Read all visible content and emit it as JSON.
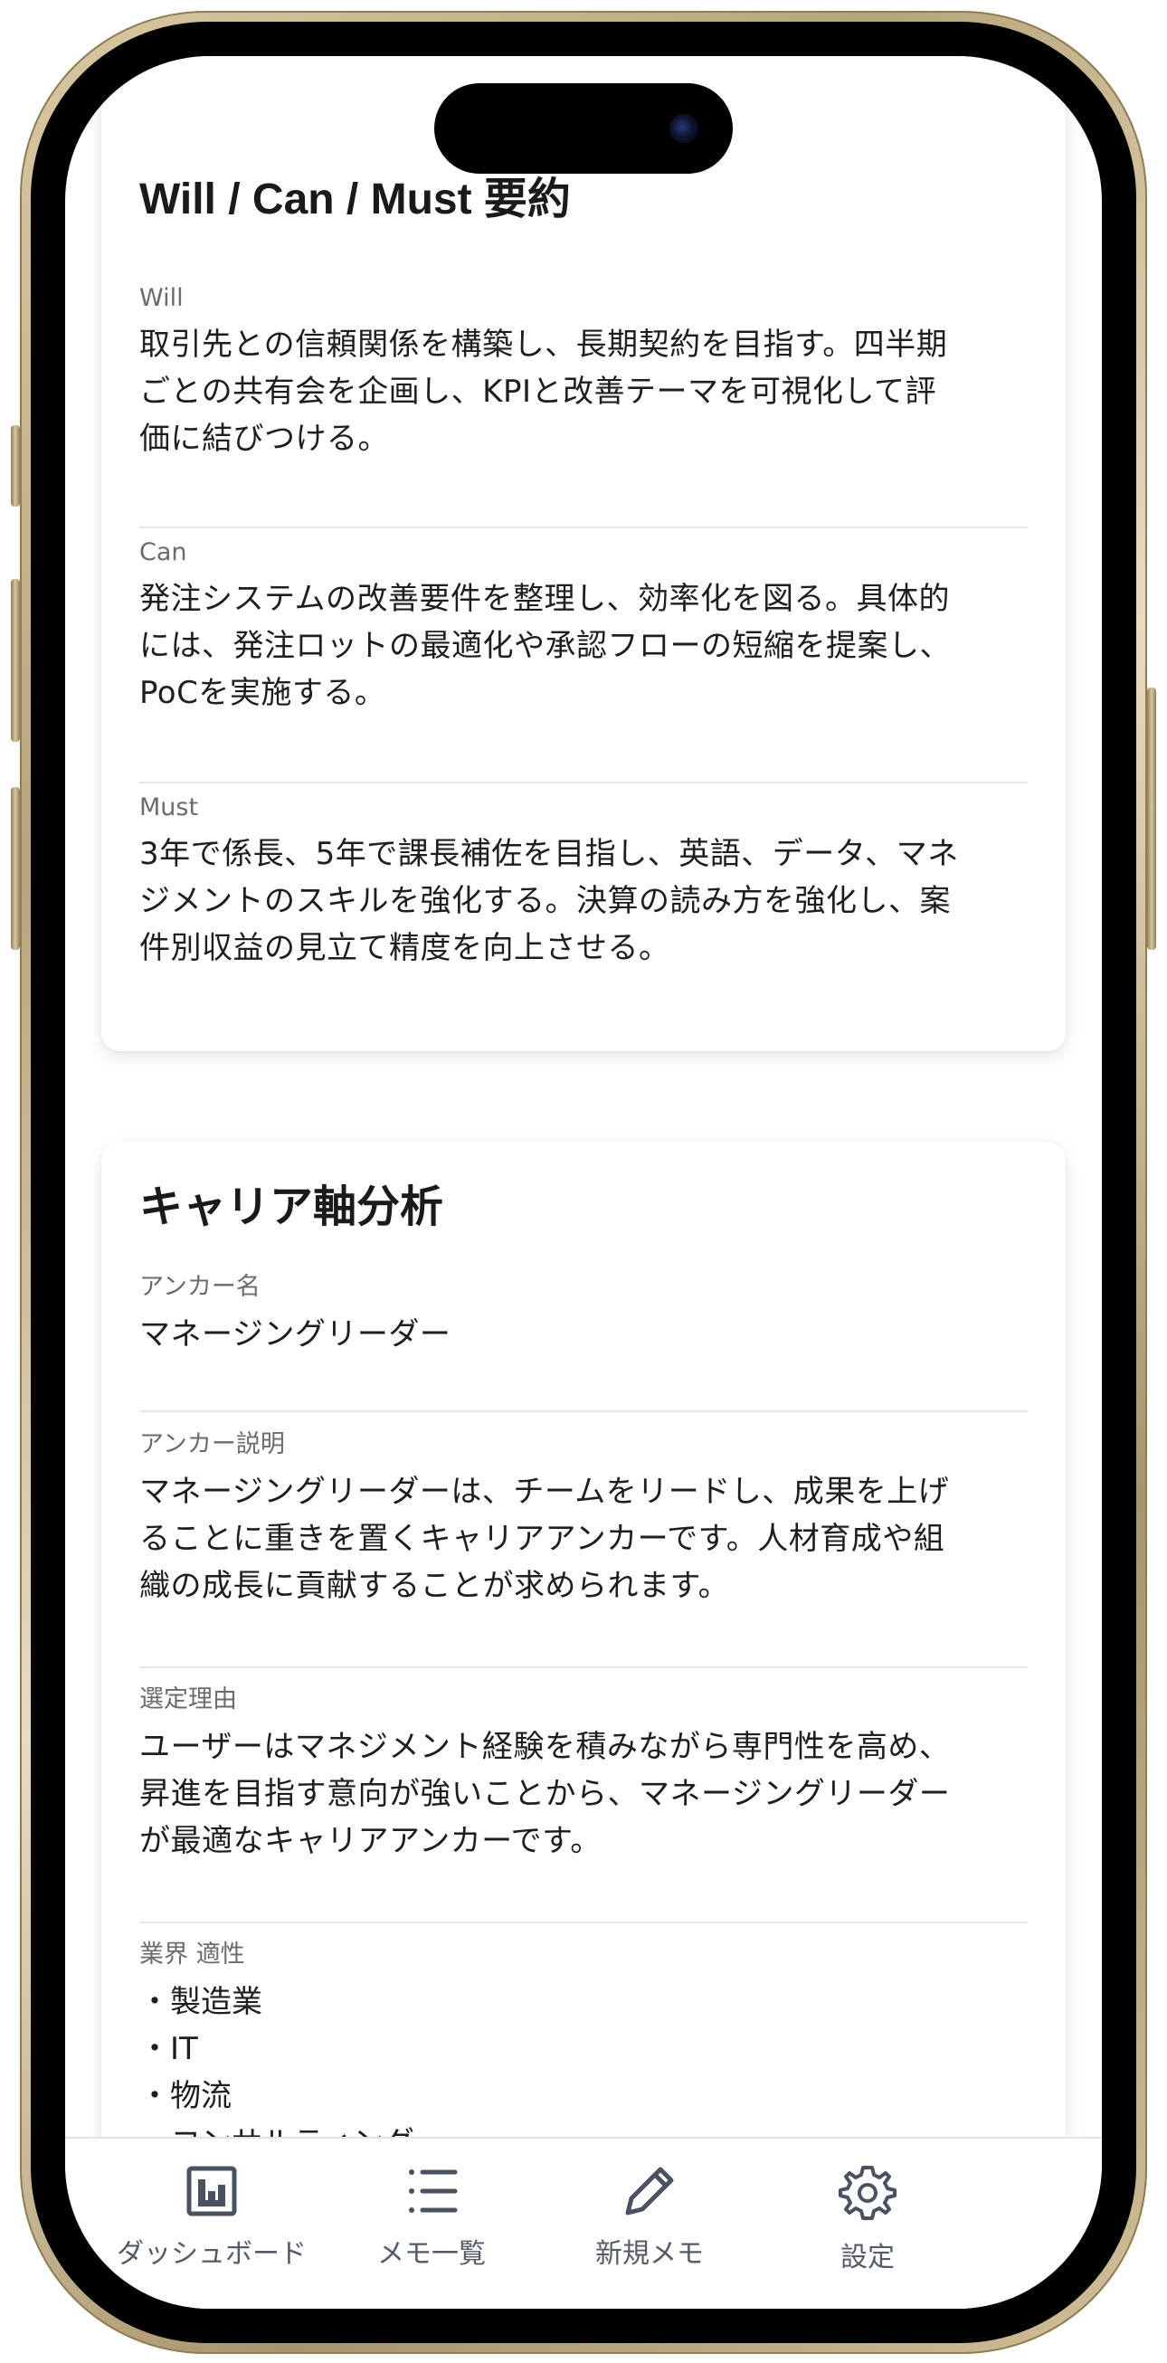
{
  "summary": {
    "title": "Will / Can / Must 要約",
    "sections": [
      {
        "label": "Will",
        "lines": [
          "取引先との信頼関係を構築し、長期契約を目指す。四半期",
          "ごとの共有会を企画し、KPIと改善テーマを可視化して評",
          "価に結びつける。"
        ]
      },
      {
        "label": "Can",
        "lines": [
          "発注システムの改善要件を整理し、効率化を図る。具体的",
          "には、発注ロットの最適化や承認フローの短縮を提案し、",
          "PoCを実施する。"
        ]
      },
      {
        "label": "Must",
        "lines": [
          "3年で係長、5年で課長補佐を目指し、英語、データ、マネ",
          "ジメントのスキルを強化する。決算の読み方を強化し、案",
          "件別収益の見立て精度を向上させる。"
        ]
      }
    ]
  },
  "career": {
    "title": "キャリア軸分析",
    "anchor_name_label": "アンカー名",
    "anchor_name": "マネージングリーダー",
    "anchor_desc_label": "アンカー説明",
    "anchor_desc_lines": [
      "マネージングリーダーは、チームをリードし、成果を上げ",
      "ることに重きを置くキャリアアンカーです。人材育成や組",
      "織の成長に貢献することが求められます。"
    ],
    "reason_label": "選定理由",
    "reason_lines": [
      "ユーザーはマネジメント経験を積みながら専門性を高め、",
      "昇進を目指す意向が強いことから、マネージングリーダー",
      "が最適なキャリアアンカーです。"
    ],
    "industry_label": "業界 適性",
    "industries": [
      "製造業",
      "IT",
      "物流",
      "コンサルティング"
    ]
  },
  "tabbar": {
    "items": [
      {
        "label": "ダッシュボード",
        "icon": "dashboard-icon"
      },
      {
        "label": "メモ一覧",
        "icon": "list-icon"
      },
      {
        "label": "新規メモ",
        "icon": "pencil-icon"
      },
      {
        "label": "設定",
        "icon": "gear-icon"
      }
    ]
  },
  "colors": {
    "icon": "#4a5160",
    "divider": "#e6e6e6",
    "frame_gold": "#c9b88f"
  }
}
